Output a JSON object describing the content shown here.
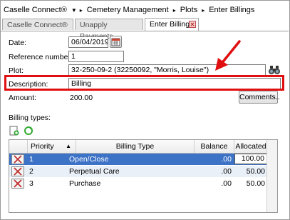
{
  "breadcrumb": [
    "Caselle Connect®",
    "Cemetery Management",
    "Plots",
    "Enter Billings"
  ],
  "tabs": [
    {
      "label": "Caselle Connect®"
    },
    {
      "label": "Unapply Payments"
    },
    {
      "label": "Enter Billings"
    }
  ],
  "form": {
    "date_label": "Date:",
    "date_value": "06/04/2019",
    "ref_label": "Reference number:",
    "ref_value": "1",
    "plot_label": "Plot:",
    "plot_value": "32-250-09-2 (32250092, \"Morris, Louise\")",
    "desc_label": "Description:",
    "desc_value": "Billing",
    "amount_label": "Amount:",
    "amount_value": "200.00",
    "comments_label": "Comments.."
  },
  "billing_types": {
    "label": "Billing types:",
    "columns": [
      "Priority",
      "Billing Type",
      "Balance",
      "Allocated"
    ],
    "rows": [
      {
        "priority": "1",
        "type": "Open/Close",
        "balance": ".00",
        "allocated": "100.00"
      },
      {
        "priority": "2",
        "type": "Perpetual Care",
        "balance": ".00",
        "allocated": "50.00"
      },
      {
        "priority": "3",
        "type": "Purchase",
        "balance": ".00",
        "allocated": "50.00"
      }
    ]
  },
  "colors": {
    "selected_row": "#3d73c7",
    "annotation": "#e01010",
    "alt_row": "#eaf0f8"
  }
}
